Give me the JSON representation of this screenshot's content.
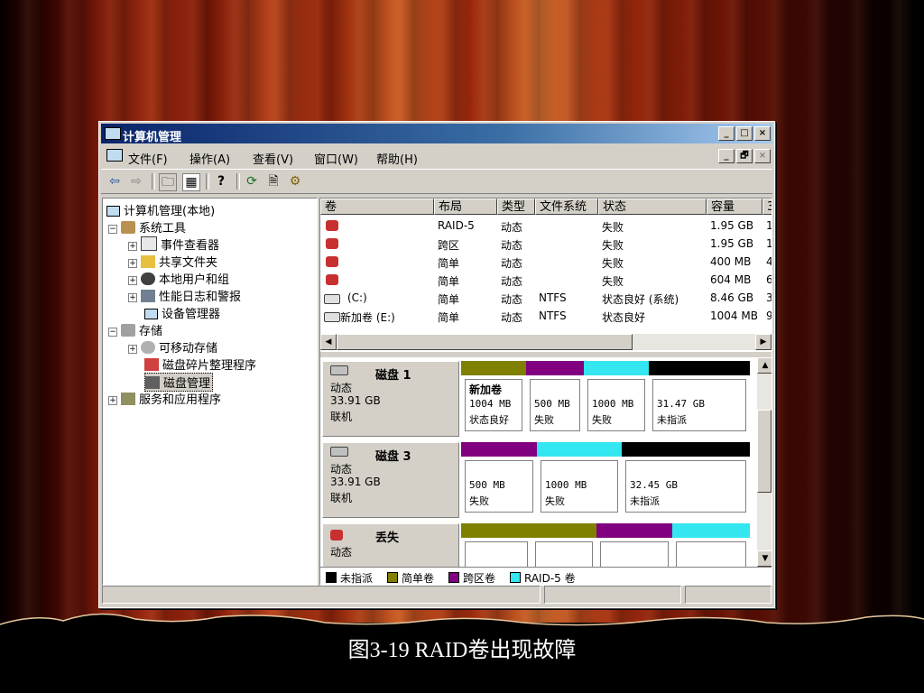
{
  "caption": "图3-19  RAID卷出现故障",
  "window": {
    "title": "计算机管理"
  },
  "menu": [
    "文件(F)",
    "操作(A)",
    "查看(V)",
    "窗口(W)",
    "帮助(H)"
  ],
  "caption_buttons": [
    "_",
    "□",
    "×"
  ],
  "mdi_buttons": [
    "_",
    "🗗",
    "×"
  ],
  "tree": [
    {
      "label": "计算机管理(本地)",
      "level": 0
    },
    {
      "label": "系统工具",
      "level": 1,
      "expander": "−"
    },
    {
      "label": "事件查看器",
      "level": 2,
      "expander": "+"
    },
    {
      "label": "共享文件夹",
      "level": 2,
      "expander": "+"
    },
    {
      "label": "本地用户和组",
      "level": 2,
      "expander": "+"
    },
    {
      "label": "性能日志和警报",
      "level": 2,
      "expander": "+"
    },
    {
      "label": "设备管理器",
      "level": 2
    },
    {
      "label": "存储",
      "level": 1,
      "expander": "−"
    },
    {
      "label": "可移动存储",
      "level": 2,
      "expander": "+"
    },
    {
      "label": "磁盘碎片整理程序",
      "level": 2
    },
    {
      "label": "磁盘管理",
      "level": 2,
      "selected": true
    },
    {
      "label": "服务和应用程序",
      "level": 1,
      "expander": "+"
    }
  ],
  "columns": [
    "卷",
    "布局",
    "类型",
    "文件系统",
    "状态",
    "容量",
    "3"
  ],
  "volumes": [
    {
      "name": "",
      "layout": "RAID-5",
      "type": "动态",
      "fs": "",
      "status": "失败",
      "capacity": "1.95 GB",
      "extra": "1",
      "failed": true
    },
    {
      "name": "",
      "layout": "跨区",
      "type": "动态",
      "fs": "",
      "status": "失败",
      "capacity": "1.95 GB",
      "extra": "1",
      "failed": true
    },
    {
      "name": "",
      "layout": "简单",
      "type": "动态",
      "fs": "",
      "status": "失败",
      "capacity": "400 MB",
      "extra": "4",
      "failed": true
    },
    {
      "name": "",
      "layout": "简单",
      "type": "动态",
      "fs": "",
      "status": "失败",
      "capacity": "604 MB",
      "extra": "6",
      "failed": true
    },
    {
      "name": "(C:)",
      "layout": "简单",
      "type": "动态",
      "fs": "NTFS",
      "status": "状态良好 (系统)",
      "capacity": "8.46 GB",
      "extra": "3",
      "failed": false
    },
    {
      "name": "新加卷 (E:)",
      "layout": "简单",
      "type": "动态",
      "fs": "NTFS",
      "status": "状态良好",
      "capacity": "1004 MB",
      "extra": "9",
      "failed": false
    }
  ],
  "disks": [
    {
      "name": "磁盘 1",
      "kind": "动态",
      "size": "33.91 GB",
      "state": "联机",
      "segments": [
        {
          "bar": "#808000",
          "title": "新加卷",
          "size": "1004 MB",
          "status": "状态良好"
        },
        {
          "bar": "#800080",
          "title": "",
          "size": "500 MB",
          "status": "失败"
        },
        {
          "bar": "#33e6f0",
          "title": "",
          "size": "1000 MB",
          "status": "失败"
        },
        {
          "bar": "#000000",
          "title": "",
          "size": "31.47 GB",
          "status": "未指派"
        }
      ]
    },
    {
      "name": "磁盘 3",
      "kind": "动态",
      "size": "33.91 GB",
      "state": "联机",
      "segments": [
        {
          "bar": "#800080",
          "title": "",
          "size": "500 MB",
          "status": "失败"
        },
        {
          "bar": "#33e6f0",
          "title": "",
          "size": "1000 MB",
          "status": "失败"
        },
        {
          "bar": "#000000",
          "title": "",
          "size": "32.45 GB",
          "status": "未指派"
        }
      ]
    },
    {
      "name": "丢失",
      "kind": "动态",
      "size": "",
      "state": "",
      "segments": [
        {
          "bar": "#808000"
        },
        {
          "bar": "#808000"
        },
        {
          "bar": "#800080"
        },
        {
          "bar": "#33e6f0"
        }
      ]
    }
  ],
  "legend": [
    {
      "label": "未指派",
      "color": "#000000"
    },
    {
      "label": "简单卷",
      "color": "#808000"
    },
    {
      "label": "跨区卷",
      "color": "#800080"
    },
    {
      "label": "RAID-5 卷",
      "color": "#33e6f0"
    }
  ],
  "toolbar_icons": [
    "back-arrow-icon",
    "forward-arrow-icon",
    "up-folder-icon",
    "show-hide-tree-icon",
    "help-icon",
    "refresh-icon",
    "properties-icon",
    "console-icon"
  ],
  "toolbar_glyphs": [
    "⇦",
    "⇨",
    "🗀",
    "▦",
    "?",
    "⟳",
    "🗎",
    "⚙"
  ]
}
